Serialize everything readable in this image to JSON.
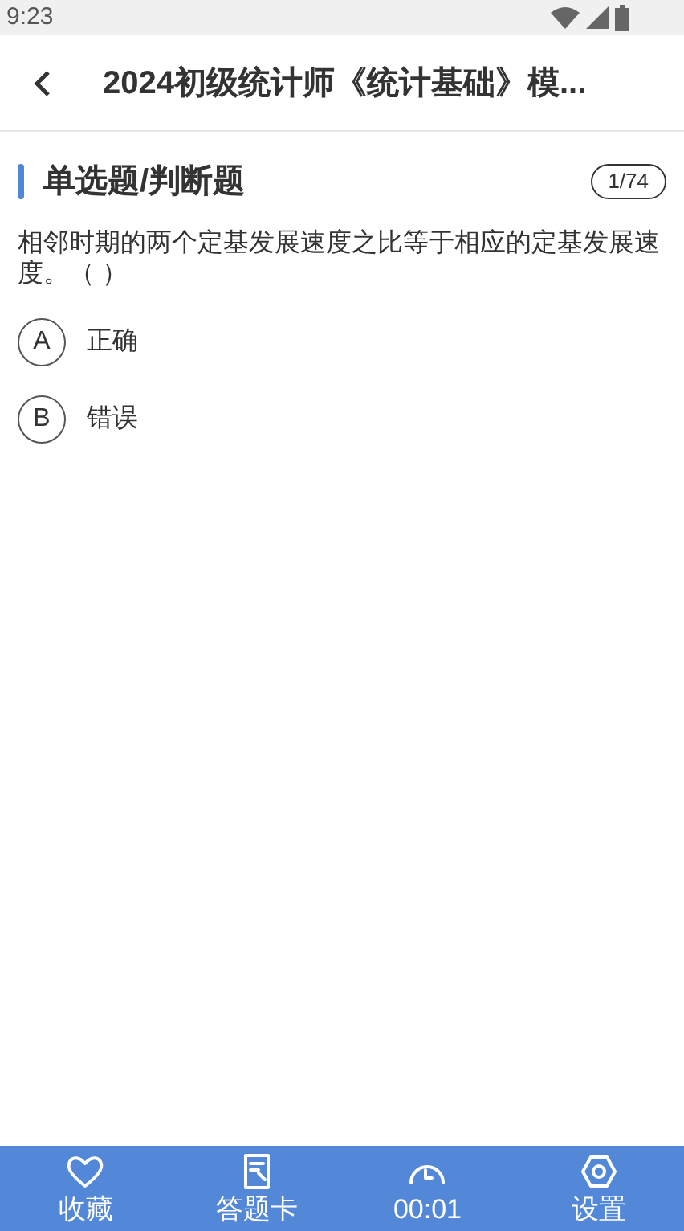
{
  "status_bar": {
    "time": "9:23"
  },
  "header": {
    "title": "2024初级统计师《统计基础》模..."
  },
  "section": {
    "title": "单选题/判断题",
    "counter": "1/74"
  },
  "question": {
    "text": "相邻时期的两个定基发展速度之比等于相应的定基发展速度。（   ）"
  },
  "options": [
    {
      "letter": "A",
      "text": "正确",
      "selected": false
    },
    {
      "letter": "B",
      "text": "错误",
      "selected": false
    }
  ],
  "bottom_bar": [
    {
      "kind": "favorite",
      "label": "收藏"
    },
    {
      "kind": "answer_card",
      "label": "答题卡"
    },
    {
      "kind": "timer",
      "label": "00:01"
    },
    {
      "kind": "settings",
      "label": "设置"
    }
  ]
}
